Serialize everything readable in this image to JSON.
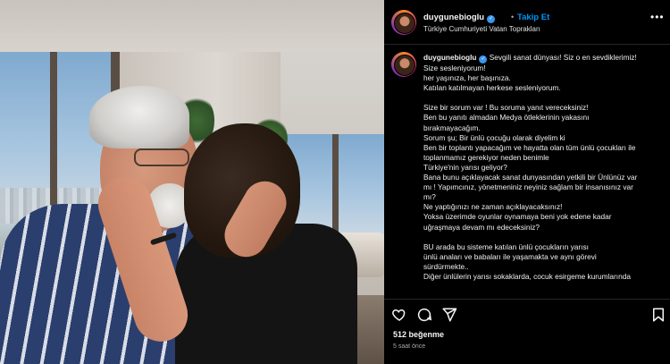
{
  "post": {
    "username": "duygunebioglu",
    "verified": true,
    "separator": "•",
    "follow_label": "Takip Et",
    "location": "Türkiye Cumhuriyeti Vatan Toprakları",
    "more_icon": "more-icon",
    "caption_lines": [
      "Sevgili sanat dünyası! Siz o en sevdiklerimiz!",
      "Size sesleniyorum!",
      "her yaşınıza, her başınıza.",
      "Katılan katılmayan herkese sesleniyorum.",
      "",
      "Size bir sorum var ! Bu soruma yanıt vereceksiniz!",
      "Ben bu yanıtı almadan Medya ötleklerinin yakasını",
      "bırakmayacağım.",
      "Sorum şu; Bir ünlü çocuğu olarak diyelim ki",
      "Ben bir toplantı yapacağım ve hayatta olan tüm ünlü çocukları ile",
      "toplanmamız gerekiyor neden benimle",
      "Türkiye'nin yarısı geliyor?",
      "Bana bunu açıklayacak sanat dunyasından yetkili bir Ünlünüz var",
      "mı ! Yapımcınız, yönetmeniniz neyiniz sağlam bir insanısınız var",
      "mı?",
      "Ne yaptığınızı ne zaman açıklayacaksınız!",
      "Yoksa üzerimde oyunlar oynamaya beni yok edene kadar",
      "uğraşmaya devam mı edeceksiniz?",
      "",
      "BU arada bu sisteme katılan ünlü çocukların yarısı",
      "ünlü anaları ve babaları ile yaşamakta ve aynı görevi",
      "sürdürmekte..",
      "Diğer ünlülerin yarısı sokaklarda, cocuk esirgeme kurumlarında"
    ],
    "likes": "512 beğenme",
    "time_ago": "5 saat önce",
    "icons": {
      "like": "heart-icon",
      "comment": "comment-icon",
      "share": "share-icon",
      "save": "bookmark-icon"
    }
  }
}
